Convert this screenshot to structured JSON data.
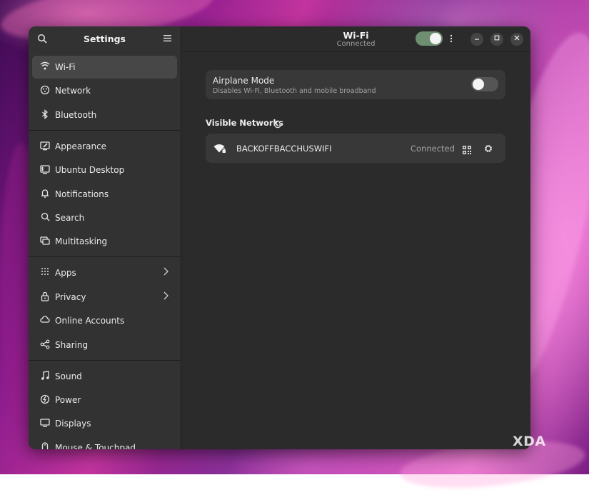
{
  "sidebar": {
    "title": "Settings",
    "items": [
      {
        "label": "Wi-Fi",
        "icon": "wifi-icon",
        "active": true
      },
      {
        "label": "Network",
        "icon": "network-icon"
      },
      {
        "label": "Bluetooth",
        "icon": "bluetooth-icon"
      },
      {
        "label": "Appearance",
        "icon": "appearance-icon"
      },
      {
        "label": "Ubuntu Desktop",
        "icon": "desktop-icon"
      },
      {
        "label": "Notifications",
        "icon": "bell-icon"
      },
      {
        "label": "Search",
        "icon": "search-icon"
      },
      {
        "label": "Multitasking",
        "icon": "multitasking-icon"
      },
      {
        "label": "Apps",
        "icon": "apps-grid-icon"
      },
      {
        "label": "Privacy",
        "icon": "lock-icon"
      },
      {
        "label": "Online Accounts",
        "icon": "cloud-icon"
      },
      {
        "label": "Sharing",
        "icon": "share-icon"
      },
      {
        "label": "Sound",
        "icon": "music-note-icon"
      },
      {
        "label": "Power",
        "icon": "power-icon"
      },
      {
        "label": "Displays",
        "icon": "monitor-icon"
      },
      {
        "label": "Mouse & Touchpad",
        "icon": "mouse-icon"
      }
    ]
  },
  "header": {
    "title": "Wi-Fi",
    "subtitle": "Connected",
    "wifi_enabled": true
  },
  "airplane": {
    "title": "Airplane Mode",
    "subtitle": "Disables Wi-Fi, Bluetooth and mobile broadband",
    "enabled": false
  },
  "visible_networks": {
    "title": "Visible Networks",
    "networks": [
      {
        "name": "BACKOFFBACCHUSWIFI",
        "status": "Connected"
      }
    ]
  },
  "watermark": "XDA",
  "colors": {
    "accent_toggle": "#6f8f72",
    "window_bg": "#2b2b2b",
    "sidebar_bg": "#323232"
  }
}
